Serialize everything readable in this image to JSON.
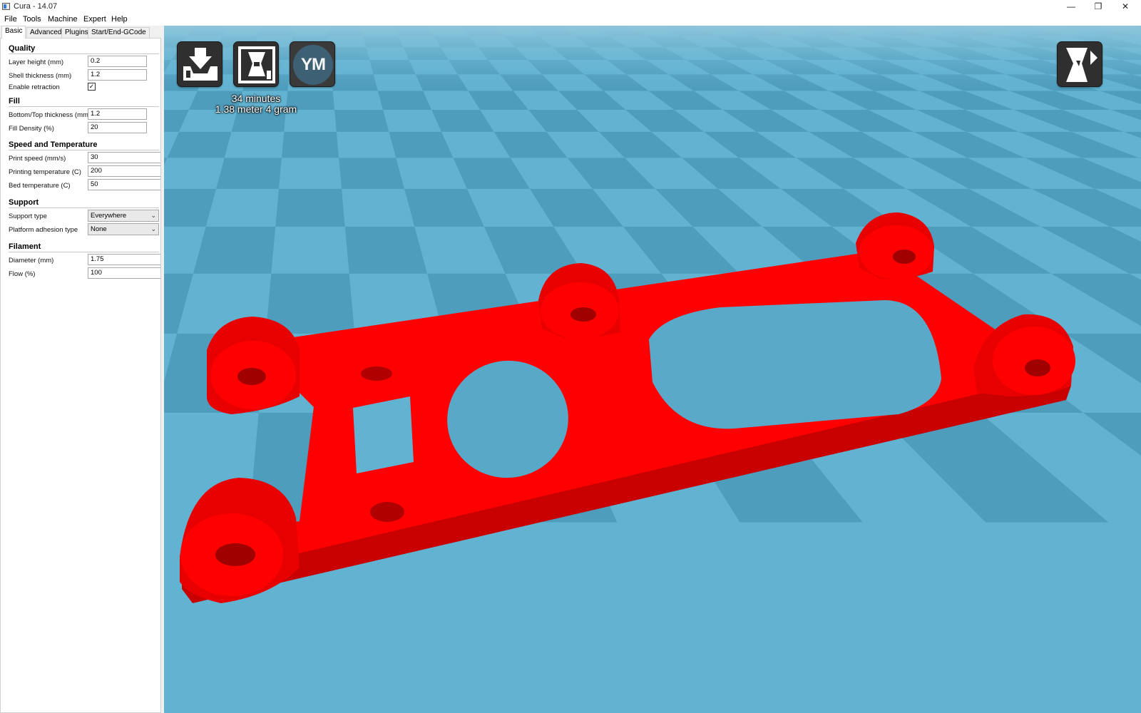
{
  "window": {
    "title": "Cura - 14.07",
    "minimize": "—",
    "maximize": "❐",
    "close": "✕"
  },
  "menu": [
    "File",
    "Tools",
    "Machine",
    "Expert",
    "Help"
  ],
  "tabs": [
    "Basic",
    "Advanced",
    "Plugins",
    "Start/End-GCode"
  ],
  "active_tab": "Basic",
  "sections": {
    "quality": {
      "title": "Quality",
      "layer_height_label": "Layer height (mm)",
      "layer_height_value": "0.2",
      "shell_thickness_label": "Shell thickness (mm)",
      "shell_thickness_value": "1.2",
      "retraction_label": "Enable retraction",
      "retraction_checked": "✓"
    },
    "fill": {
      "title": "Fill",
      "bottom_top_label": "Bottom/Top thickness (mm)",
      "bottom_top_value": "1.2",
      "fill_density_label": "Fill Density (%)",
      "fill_density_value": "20"
    },
    "speed": {
      "title": "Speed and Temperature",
      "print_speed_label": "Print speed (mm/s)",
      "print_speed_value": "30",
      "print_temp_label": "Printing temperature (C)",
      "print_temp_value": "200",
      "bed_temp_label": "Bed temperature (C)",
      "bed_temp_value": "50"
    },
    "support": {
      "title": "Support",
      "support_type_label": "Support type",
      "support_type_value": "Everywhere",
      "adhesion_label": "Platform adhesion type",
      "adhesion_value": "None",
      "chevron": "⌄"
    },
    "filament": {
      "title": "Filament",
      "diameter_label": "Diameter (mm)",
      "diameter_value": "1.75",
      "flow_label": "Flow (%)",
      "flow_value": "100"
    }
  },
  "viewport": {
    "toolbar": {
      "load_icon": "load-model-icon",
      "save_icon": "save-toolpath-icon",
      "ym_label": "YM",
      "view_mode_icon": "view-mode-icon"
    },
    "print_time": "34 minutes",
    "print_material": "1.38 meter 4 gram"
  },
  "colors": {
    "build_plate_light": "#62b3d2",
    "build_plate_dark": "#4f9dbc",
    "model": "#ff0000",
    "model_shadow": "#b30000",
    "panel_bg": "#f0f0f0",
    "toolbar_button": "#2f2f2f"
  }
}
